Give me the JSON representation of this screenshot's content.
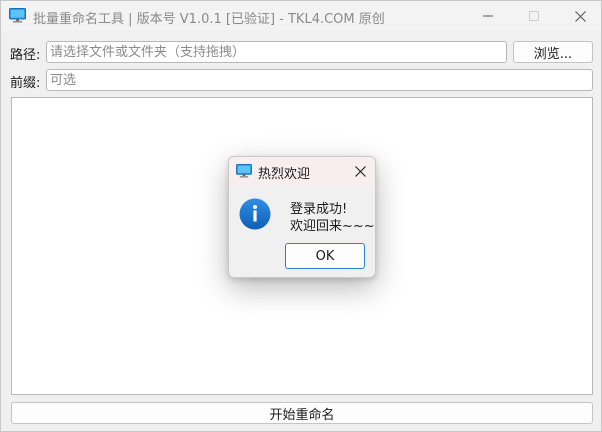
{
  "window": {
    "title": "批量重命名工具 | 版本号 V1.0.1 [已验证] - TKL4.COM 原创"
  },
  "form": {
    "path_label": "路径:",
    "path_placeholder": "请选择文件或文件夹（支持拖拽）",
    "path_value": "",
    "browse_label": "浏览...",
    "prefix_label": "前缀:",
    "prefix_placeholder": "可选",
    "prefix_value": ""
  },
  "file_list": {
    "items": []
  },
  "actions": {
    "start_rename_label": "开始重命名"
  },
  "dialog": {
    "title": "热烈欢迎",
    "message_line1": "登录成功!",
    "message_line2": "欢迎回来~~~",
    "ok_label": "OK"
  },
  "icons": {
    "app": "monitor-icon",
    "dialog": "monitor-icon",
    "info": "info-icon",
    "minimize": "minimize-icon",
    "maximize": "maximize-icon",
    "close": "close-icon"
  },
  "colors": {
    "info_blue": "#1a73d4",
    "ok_border": "#2f7fd6",
    "window_bg": "#f0f0f0"
  }
}
